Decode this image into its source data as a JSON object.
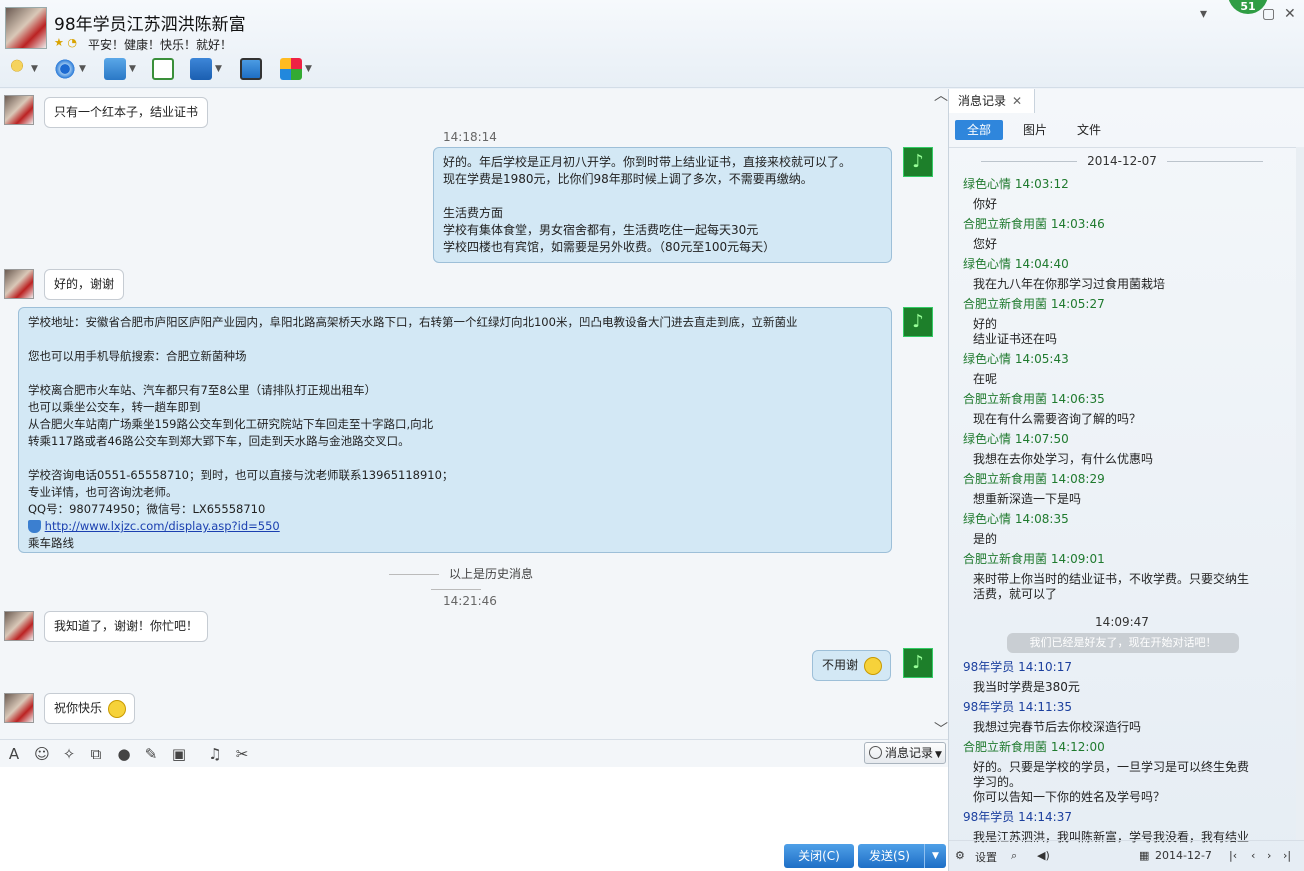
{
  "header": {
    "contact_name": "98年学员江苏泗洪陈新富",
    "signature": "平安！健康！快乐！就好！",
    "badge_count": "51"
  },
  "toolbar": {
    "icons": [
      "microphone-icon",
      "webcam-icon",
      "file-transfer-icon",
      "new-chat-icon",
      "remote-desktop-icon",
      "share-screen-icon",
      "apps-icon"
    ]
  },
  "chat": {
    "messages": [
      {
        "side": "left",
        "text": "只有一个红本子，结业证书"
      },
      {
        "time": "14:18:14"
      },
      {
        "side": "right",
        "text": "好的。年后学校是正月初八开学。你到时带上结业证书，直接来校就可以了。\n现在学费是1980元，比你们98年那时候上调了多次，不需要再缴纳。\n\n生活费方面\n学校有集体食堂，男女宿舍都有，生活费吃住一起每天30元\n学校四楼也有宾馆，如需要是另外收费。（80元至100元每天）"
      },
      {
        "side": "left",
        "text": "好的，谢谢"
      },
      {
        "side": "right",
        "text": "学校地址：安徽省合肥市庐阳区庐阳产业园内，阜阳北路高架桥天水路下口，右转第一个红绿灯向北100米，凹凸电教设备大门进去直走到底，立新菌业\n\n您也可以用手机导航搜索：合肥立新菌种场\n\n学校离合肥市火车站、汽车都只有7至8公里（请排队打正规出租车）\n也可以乘坐公交车，转一趟车即到\n从合肥火车站南广场乘坐159路公交车到化工研究院站下车回走至十字路口,向北\n转乘117路或者46路公交车到郑大郢下车，回走到天水路与金池路交叉口。\n\n学校咨询电话0551-65558710；到时，也可以直接与沈老师联系13965118910；\n专业详情，也可咨询沈老师。\nQQ号：980774950；微信号：LX65558710",
        "link": "http://www.lxjzc.com/display.asp?id=550",
        "after_link": "乘车路线"
      },
      {
        "history_divider": "以上是历史消息"
      },
      {
        "time": "14:21:46"
      },
      {
        "side": "left",
        "text": "我知道了，谢谢！你忙吧！"
      },
      {
        "side": "right",
        "text": "不用谢"
      },
      {
        "side": "left",
        "text": "祝你快乐"
      }
    ]
  },
  "input_toolbar": {
    "icons": [
      "font-icon",
      "emoji-icon",
      "magic-icon",
      "screenshot-icon",
      "voice-icon",
      "edit-icon",
      "image-icon",
      "music-icon",
      "scissors-icon"
    ],
    "history_button": "消息记录"
  },
  "buttons": {
    "close": "关闭(C)",
    "send": "发送(S)"
  },
  "side_panel": {
    "tab_title": "消息记录",
    "filters": [
      "全部",
      "图片",
      "文件"
    ],
    "date": "2014-12-07",
    "entries": [
      {
        "who": "绿色心情 14:03:12",
        "color": "green",
        "text": "你好"
      },
      {
        "who": "合肥立新食用菌 14:03:46",
        "color": "green",
        "text": "您好"
      },
      {
        "who": "绿色心情 14:04:40",
        "color": "green",
        "text": "我在九八年在你那学习过食用菌栽培"
      },
      {
        "who": "合肥立新食用菌 14:05:27",
        "color": "green",
        "text": "好的\n结业证书还在吗"
      },
      {
        "who": "绿色心情 14:05:43",
        "color": "green",
        "text": "在呢"
      },
      {
        "who": "合肥立新食用菌 14:06:35",
        "color": "green",
        "text": "现在有什么需要咨询了解的吗？"
      },
      {
        "who": "绿色心情 14:07:50",
        "color": "green",
        "text": "我想在去你处学习，有什么优惠吗"
      },
      {
        "who": "合肥立新食用菌 14:08:29",
        "color": "green",
        "text": "想重新深造一下是吗"
      },
      {
        "who": "绿色心情 14:08:35",
        "color": "green",
        "text": "是的"
      },
      {
        "who": "合肥立新食用菌 14:09:01",
        "color": "green",
        "text": "来时带上你当时的结业证书，不收学费。只要交纳生\n活费，就可以了"
      },
      {
        "who": "98年学员 14:10:17",
        "color": "blue",
        "text": "我当时学费是380元"
      },
      {
        "who": "98年学员 14:11:35",
        "color": "blue",
        "text": "我想过完春节后去你校深造行吗"
      },
      {
        "who": "合肥立新食用菌 14:12:00",
        "color": "green",
        "text": "好的。只要是学校的学员，一旦学习是可以终生免费\n学习的。\n你可以告知一下你的姓名及学号吗？"
      },
      {
        "who": "98年学员 14:14:37",
        "color": "blue",
        "text": "我是江苏泗洪，我叫陈新富，学号我没看，我有结业"
      }
    ],
    "sys_time": "14:09:47",
    "sys_note": "我们已经是好友了，现在开始对话吧！",
    "footer": {
      "settings": "设置",
      "date": "2014-12-7"
    }
  },
  "colors": {
    "accent": "#2f86dc",
    "green_name": "#1f7a2e",
    "blue_name": "#1b3f9e",
    "bubble_me": "#d3e8f5"
  }
}
